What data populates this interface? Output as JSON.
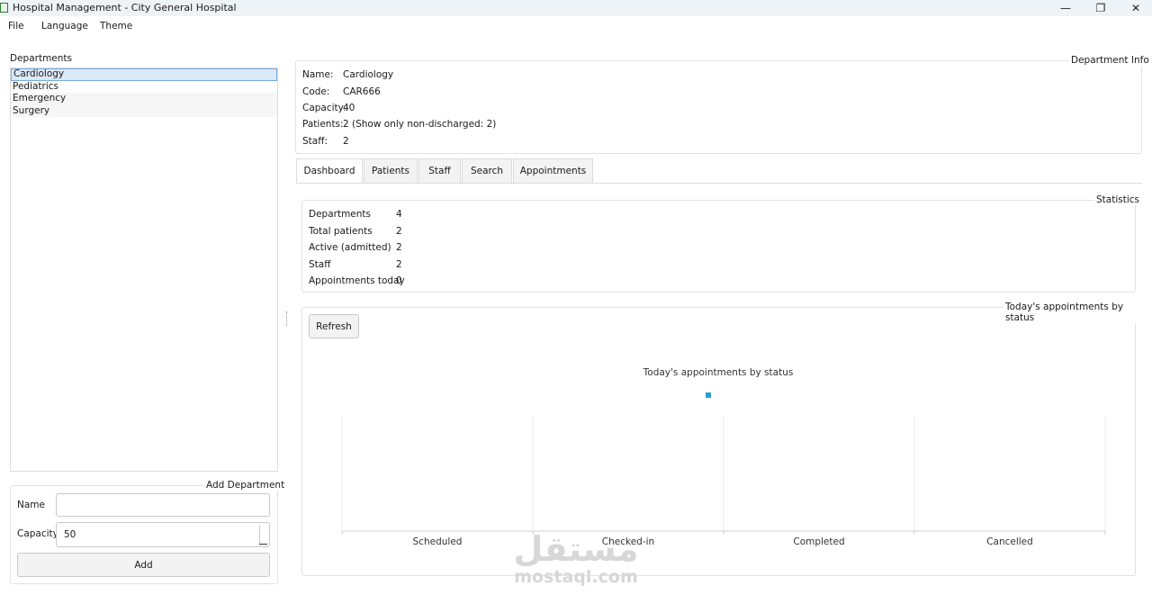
{
  "window": {
    "title": "Hospital Management - City General Hospital",
    "minimize": "—",
    "restore": "❐",
    "close": "✕"
  },
  "menu": {
    "file": "File",
    "language": "Language",
    "theme": "Theme"
  },
  "departments": {
    "title": "Departments",
    "items": [
      "Cardiology",
      "Pediatrics",
      "Emergency",
      "Surgery"
    ],
    "selected": "Cardiology"
  },
  "add_department": {
    "title": "Add Department",
    "name_label": "Name",
    "name_value": "",
    "capacity_label": "Capacity",
    "capacity_value": "50",
    "add_button": "Add"
  },
  "department_info": {
    "title": "Department Info",
    "rows": [
      {
        "key": "Name:",
        "value": "Cardiology"
      },
      {
        "key": "Code:",
        "value": "CAR666"
      },
      {
        "key": "Capacity:",
        "value": "40"
      },
      {
        "key": "Patients:",
        "value": "2 (Show only non-discharged: 2)"
      },
      {
        "key": "Staff:",
        "value": "2"
      }
    ]
  },
  "tabs": [
    "Dashboard",
    "Patients",
    "Staff",
    "Search",
    "Appointments"
  ],
  "active_tab": "Dashboard",
  "statistics": {
    "title": "Statistics",
    "rows": [
      {
        "key": "Departments",
        "value": "4"
      },
      {
        "key": "Total patients",
        "value": "2"
      },
      {
        "key": "Active (admitted)",
        "value": "2"
      },
      {
        "key": "Staff",
        "value": "2"
      },
      {
        "key": "Appointments today",
        "value": "0"
      }
    ]
  },
  "appointments_panel": {
    "title": "Today's appointments by status",
    "refresh_button": "Refresh"
  },
  "chart_data": {
    "type": "bar",
    "title": "Today's appointments by status",
    "categories": [
      "Scheduled",
      "Checked-in",
      "Completed",
      "Cancelled"
    ],
    "series": [
      {
        "values": [
          0,
          0,
          0,
          0
        ],
        "color": "#2a9fd6"
      }
    ],
    "legend": "top-center",
    "grid": true
  },
  "watermark": {
    "arabic": "مستقل",
    "latin": "mostaql.com"
  }
}
